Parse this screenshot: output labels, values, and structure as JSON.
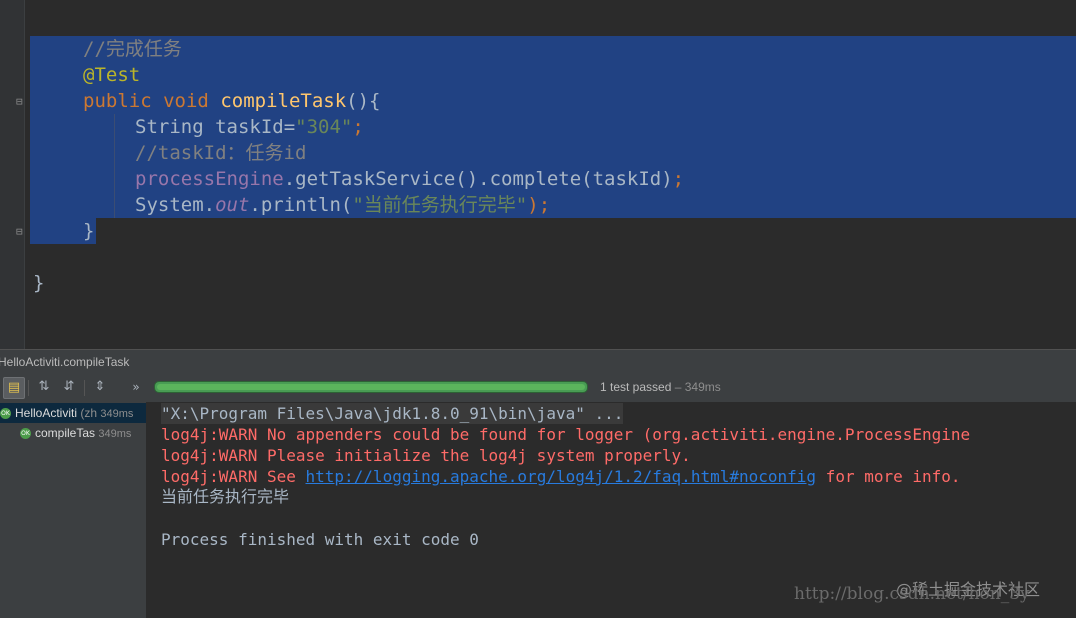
{
  "editor": {
    "lines": {
      "comment": "//完成任务",
      "annotation": "@Test",
      "kw_public": "public",
      "kw_void": "void",
      "method_name": "compileTask",
      "method_parens": "(){",
      "string_type": "String",
      "var_decl": " taskId=",
      "task_id_value": "\"304\"",
      "semicolon": ";",
      "comment2": "//taskId：任务id",
      "process_engine": "processEngine",
      "call_chain": ".getTaskService().complete(taskId)",
      "system": "System.",
      "out": "out",
      "println": ".println(",
      "println_arg": "\"当前任务执行完毕\"",
      "println_end": ");",
      "close_method": "}",
      "close_class": "}"
    }
  },
  "run_panel": {
    "title": "HelloActiviti.compileTask",
    "progress_percent": 100,
    "status": "1 test passed",
    "status_duration": " – 349ms",
    "toolbar_more": "»",
    "tree": [
      {
        "name": "HelloActiviti",
        "sub": " (zh",
        "time": "349ms",
        "selected": true
      },
      {
        "name": "compileTas",
        "sub": "",
        "time": "349ms",
        "selected": false
      }
    ],
    "ok_label": "OK"
  },
  "console": {
    "cmd": "\"X:\\Program Files\\Java\\jdk1.8.0_91\\bin\\java\" ...",
    "warn1": "log4j:WARN No appenders could be found for logger (org.activiti.engine.ProcessEngine",
    "warn2": "log4j:WARN Please initialize the log4j system properly.",
    "warn3_pre": "log4j:WARN See ",
    "warn3_link": "http://logging.apache.org/log4j/1.2/faq.html#noconfig",
    "warn3_post": " for more info.",
    "output": "当前任务执行完毕",
    "exit": "Process finished with exit code 0"
  },
  "watermark": {
    "text": "@稀土掘金技术社区",
    "url": "http://blog.csdn.net/hon_3y"
  }
}
